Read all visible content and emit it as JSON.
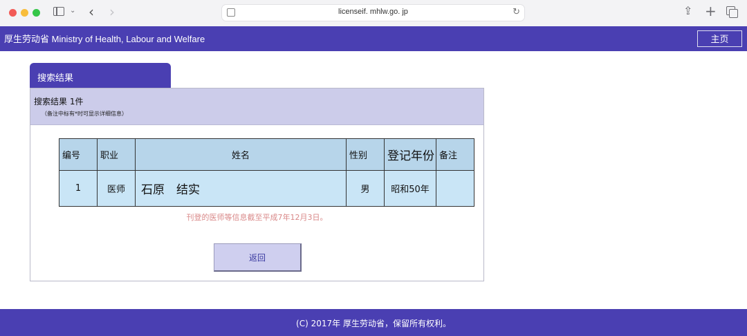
{
  "browser": {
    "url": "licenseif. mhlw.go. jp"
  },
  "header": {
    "title": "厚生劳动省 Ministry of Health, Labour and Welfare",
    "home_label": "主页"
  },
  "result": {
    "tab_label": "搜索结果",
    "count_text": "搜索结果  1件",
    "note": "（备注中标有*时可显示详细信息）",
    "columns": [
      "编号",
      "职业",
      "姓名",
      "性别",
      "登记年份",
      "备注"
    ],
    "rows": [
      {
        "no": "1",
        "occupation": "医师",
        "name": "石原　结实",
        "gender": "男",
        "year": "昭和50年",
        "remark": ""
      }
    ],
    "disclaimer": "刊登的医师等信息截至平成7年12月3日。",
    "back_label": "返回"
  },
  "footer": {
    "copyright": "(C)  2017年 厚生劳动省，保留所有权利。"
  },
  "colors": {
    "brand": "#4a3fb2",
    "panel_header": "#ccccea",
    "table_cell": "#c9e5f6",
    "table_header": "#b7d5ea",
    "disclaimer": "#d98888"
  }
}
